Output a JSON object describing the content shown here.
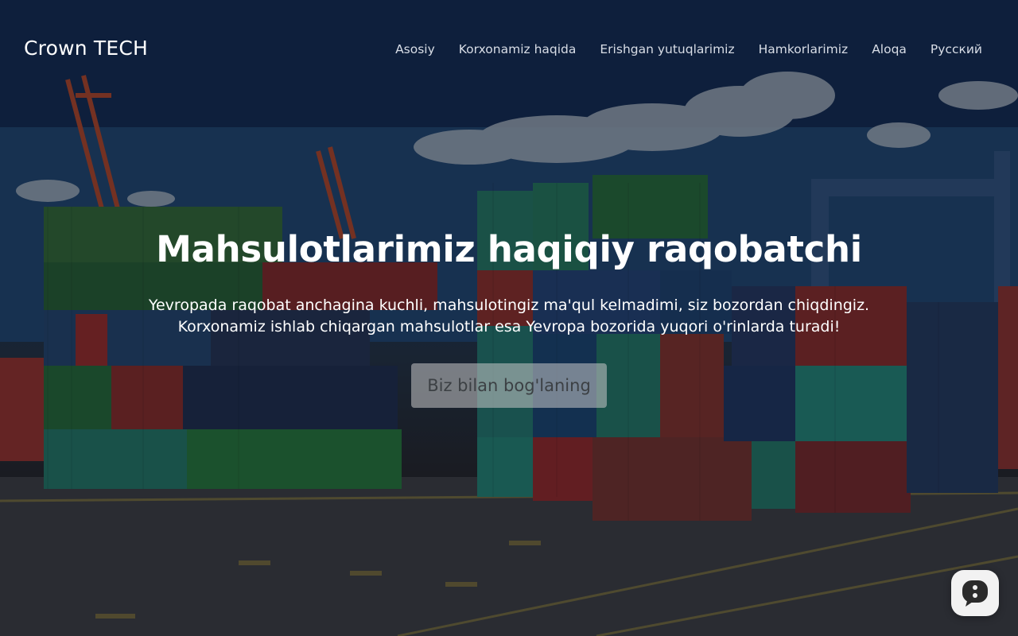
{
  "navbar": {
    "brand": "Crown TECH",
    "items": [
      {
        "label": "Asosiy"
      },
      {
        "label": "Korxonamiz haqida"
      },
      {
        "label": "Erishgan yutuqlarimiz"
      },
      {
        "label": "Hamkorlarimiz"
      },
      {
        "label": "Aloqa"
      },
      {
        "label": "Русский"
      }
    ]
  },
  "hero": {
    "title": "Mahsulotlarimiz haqiqiy raqobatchi",
    "text_line1": "Yevropada raqobat anchagina kuchli, mahsulotingiz ma'qul kelmadimi, siz bozordan chiqdingiz.",
    "text_line2": "Korxonamiz ishlab chiqargan mahsulotlar esa Yevropa bozorida yuqori o'rinlarda turadi!",
    "cta_label": "Biz bilan bog'laning",
    "background_image": "container-port-photo"
  },
  "chat_widget": {
    "icon": "chat-bubble-icon"
  },
  "colors": {
    "text_primary": "#ffffff",
    "nav_text": "#d8dde6",
    "cta_background": "#c8c8c8",
    "cta_text": "#3c4044"
  }
}
